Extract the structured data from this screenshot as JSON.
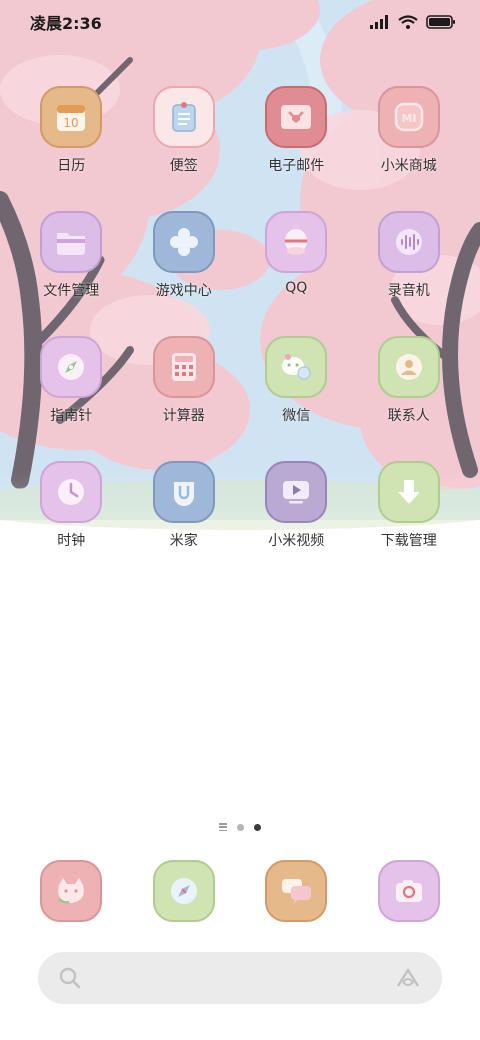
{
  "status_bar": {
    "time": "凌晨2:36",
    "icons": [
      "signal-icon",
      "wifi-icon",
      "battery-icon"
    ]
  },
  "apps": [
    {
      "label": "日历",
      "icon": "calendar-icon",
      "color": "#e6b98b"
    },
    {
      "label": "便签",
      "icon": "notes-icon",
      "color": "#f4c6c8"
    },
    {
      "label": "电子邮件",
      "icon": "mail-icon",
      "color": "#df8d92"
    },
    {
      "label": "小米商城",
      "icon": "mi-store-icon",
      "color": "#eeb1b4"
    },
    {
      "label": "文件管理",
      "icon": "folder-icon",
      "color": "#dcbde8"
    },
    {
      "label": "游戏中心",
      "icon": "game-center-icon",
      "color": "#9fb7d8"
    },
    {
      "label": "QQ",
      "icon": "qq-icon",
      "color": "#e5c2ea"
    },
    {
      "label": "录音机",
      "icon": "recorder-icon",
      "color": "#dcbde8"
    },
    {
      "label": "指南针",
      "icon": "compass-icon",
      "color": "#e5c2ea"
    },
    {
      "label": "计算器",
      "icon": "calculator-icon",
      "color": "#eeb1b4"
    },
    {
      "label": "微信",
      "icon": "wechat-icon",
      "color": "#cfe4b2"
    },
    {
      "label": "联系人",
      "icon": "contacts-icon",
      "color": "#cfe4b2"
    },
    {
      "label": "时钟",
      "icon": "clock-icon",
      "color": "#e5c2ea"
    },
    {
      "label": "米家",
      "icon": "mijia-icon",
      "color": "#9fb7d8"
    },
    {
      "label": "小米视频",
      "icon": "video-icon",
      "color": "#b9a9d3"
    },
    {
      "label": "下载管理",
      "icon": "download-icon",
      "color": "#cfe4b2"
    }
  ],
  "page_indicator": {
    "pages": 2,
    "active": 2
  },
  "dock": [
    {
      "icon": "phone-cat-icon",
      "color": "#eeb1b4"
    },
    {
      "icon": "browser-icon",
      "color": "#cfe4b2"
    },
    {
      "icon": "messages-icon",
      "color": "#e6b98b"
    },
    {
      "icon": "camera-icon",
      "color": "#e5c2ea"
    }
  ],
  "search_bar": {
    "search_icon": "search-icon",
    "assistant_icon": "assistant-icon"
  },
  "wallpaper": {
    "sky": "#cfe3f2",
    "blossom": "#f3c9d1",
    "trunk": "#6f6670"
  }
}
